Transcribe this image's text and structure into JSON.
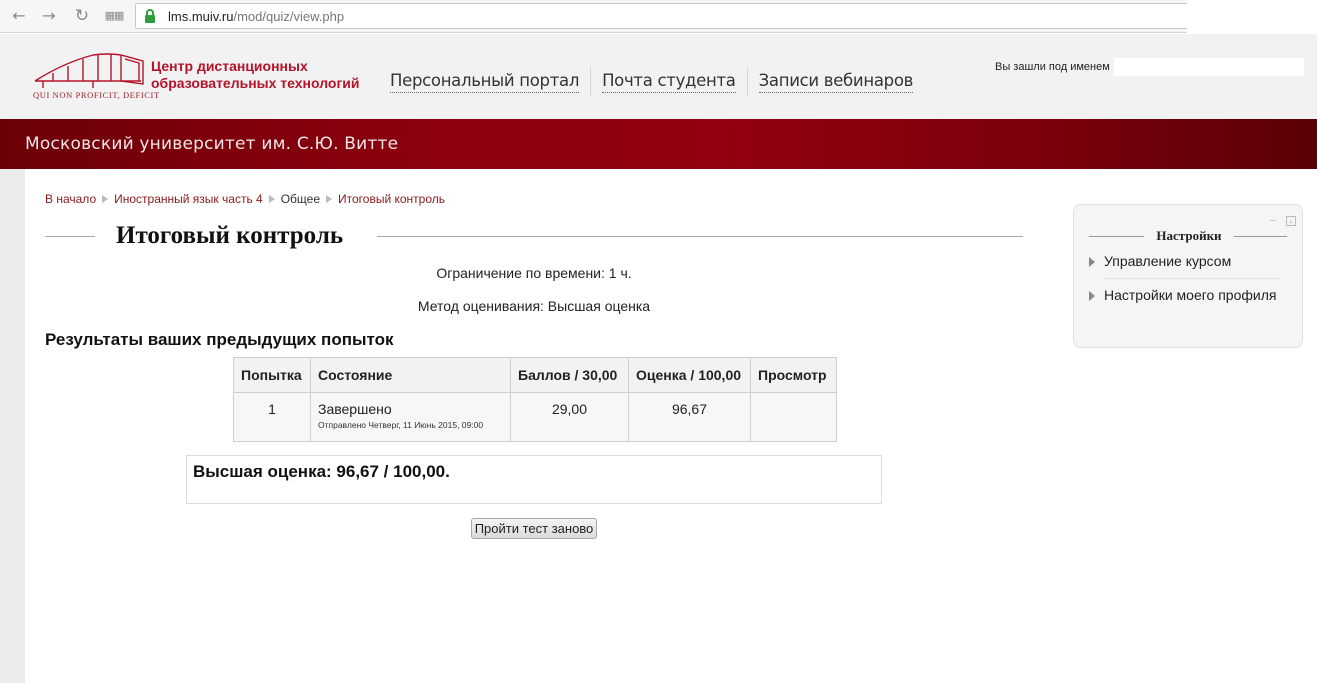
{
  "browser": {
    "url_host": "lms.muiv.ru",
    "url_path": "/mod/quiz/view.php",
    "icons": [
      "back-arrow-icon",
      "forward-arrow-icon",
      "reload-icon",
      "apps-grid-icon",
      "lock-icon"
    ]
  },
  "header": {
    "logo_title": "Центр дистанционных\nобразовательных технологий",
    "logo_motto": "QUI NON PROFICIT, DEFICIT",
    "nav": [
      "Персональный портал",
      "Почта студента",
      "Записи вебинаров"
    ],
    "login_text": "Вы зашли под именем",
    "university": "Московский университет им. С.Ю. Витте"
  },
  "breadcrumb": [
    "В начало",
    "Иностранный язык часть 4",
    "Общее",
    "Итоговый контроль"
  ],
  "page": {
    "title": "Итоговый контроль",
    "time_limit": "Ограничение по времени: 1 ч.",
    "grading_method": "Метод оценивания: Высшая оценка",
    "section_title": "Результаты ваших предыдущих попыток",
    "best_grade": "Высшая оценка: 96,67 / 100,00.",
    "retry_button": "Пройти тест заново"
  },
  "attempts_table": {
    "headers": [
      "Попытка",
      "Состояние",
      "Баллов / 30,00",
      "Оценка / 100,00",
      "Просмотр"
    ],
    "rows": [
      {
        "attempt": "1",
        "state": "Завершено",
        "state_detail": "Отправлено Четверг, 11 Июнь 2015, 09:00",
        "marks": "29,00",
        "grade": "96,67",
        "review": ""
      }
    ]
  },
  "settings_block": {
    "title": "Настройки",
    "items": [
      "Управление курсом",
      "Настройки моего профиля"
    ]
  },
  "colors": {
    "brand_red": "#b4132a",
    "band_dark": "#6c0008",
    "band_mid": "#930010",
    "link": "#8b1a1a"
  }
}
